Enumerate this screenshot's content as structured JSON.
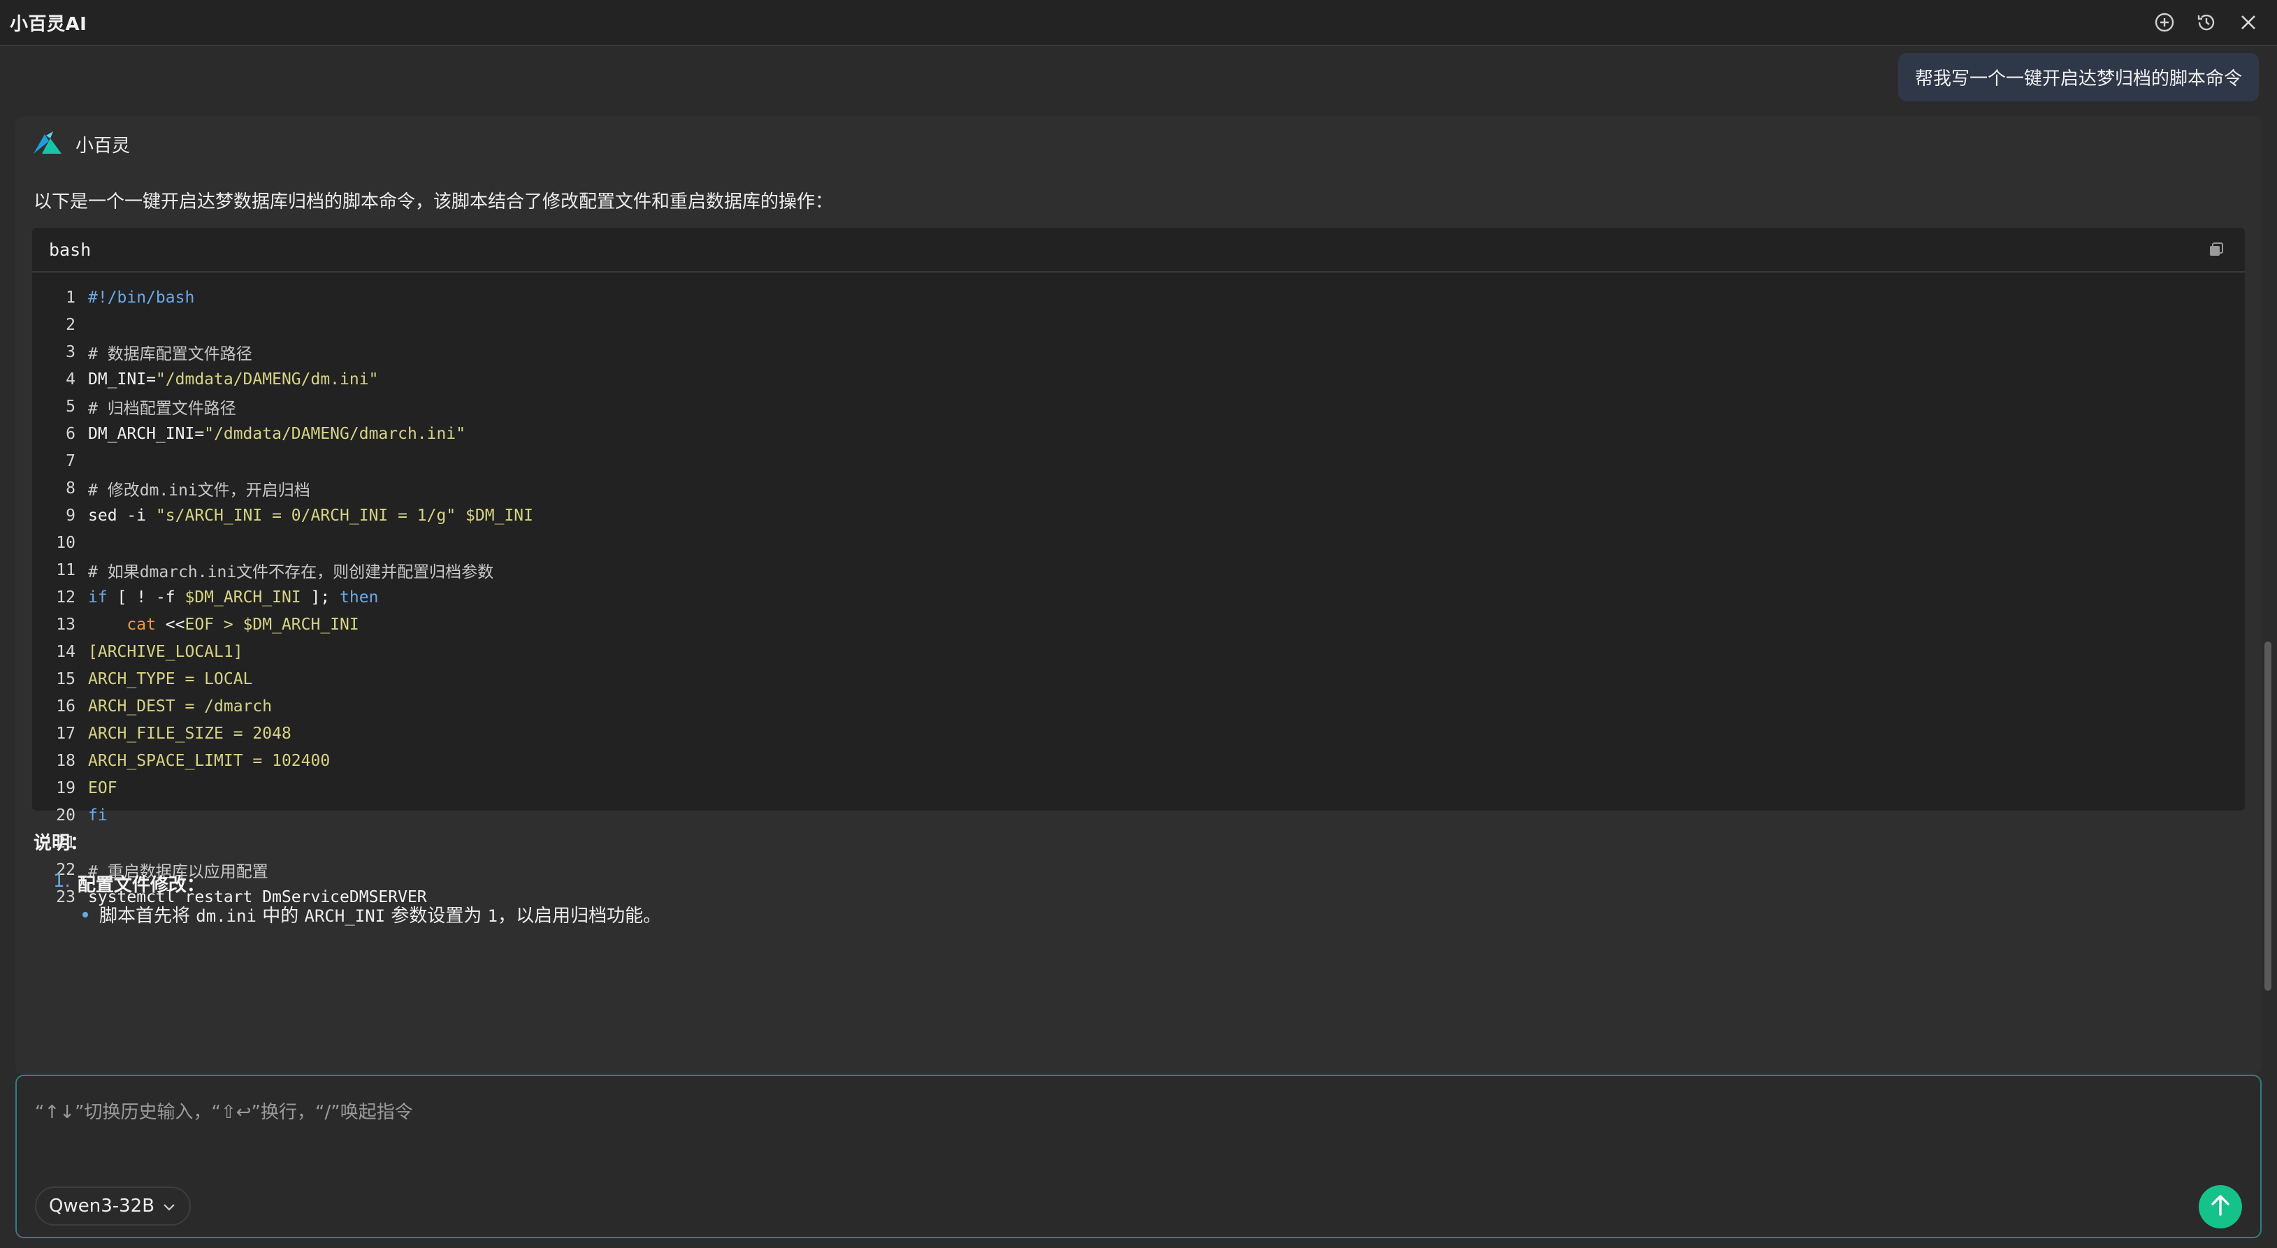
{
  "app": {
    "title": "小百灵AI"
  },
  "titlebar": {
    "icons": [
      "new-chat-icon",
      "history-icon",
      "close-icon"
    ]
  },
  "conversation": {
    "user_message": "帮我写一个一键开启达梦归档的脚本命令",
    "bot_name": "小百灵",
    "intro": "以下是一个一键开启达梦数据库归档的脚本命令，该脚本结合了修改配置文件和重启数据库的操作：",
    "code": {
      "lang": "bash",
      "lines": [
        {
          "n": "1",
          "segments": [
            {
              "t": "#!/bin/bash",
              "c": "kw"
            }
          ]
        },
        {
          "n": "2",
          "segments": []
        },
        {
          "n": "3",
          "segments": [
            {
              "t": "# 数据库配置文件路径",
              "c": "comment"
            }
          ]
        },
        {
          "n": "4",
          "segments": [
            {
              "t": "DM_INI=",
              "c": "plain"
            },
            {
              "t": "\"/dmdata/DAMENG/dm.ini\"",
              "c": "str"
            }
          ]
        },
        {
          "n": "5",
          "segments": [
            {
              "t": "# 归档配置文件路径",
              "c": "comment"
            }
          ]
        },
        {
          "n": "6",
          "segments": [
            {
              "t": "DM_ARCH_INI=",
              "c": "plain"
            },
            {
              "t": "\"/dmdata/DAMENG/dmarch.ini\"",
              "c": "str"
            }
          ]
        },
        {
          "n": "7",
          "segments": []
        },
        {
          "n": "8",
          "segments": [
            {
              "t": "# 修改dm.ini文件，开启归档",
              "c": "comment"
            }
          ]
        },
        {
          "n": "9",
          "segments": [
            {
              "t": "sed -i ",
              "c": "plain"
            },
            {
              "t": "\"s/ARCH_INI = 0/ARCH_INI = 1/g\"",
              "c": "str"
            },
            {
              "t": " $DM_INI",
              "c": "var"
            }
          ]
        },
        {
          "n": "10",
          "segments": []
        },
        {
          "n": "11",
          "segments": [
            {
              "t": "# 如果dmarch.ini文件不存在，则创建并配置归档参数",
              "c": "comment"
            }
          ]
        },
        {
          "n": "12",
          "segments": [
            {
              "t": "if",
              "c": "kw"
            },
            {
              "t": " [ ! -f ",
              "c": "plain"
            },
            {
              "t": "$DM_ARCH_INI",
              "c": "var"
            },
            {
              "t": " ]; ",
              "c": "plain"
            },
            {
              "t": "then",
              "c": "kw"
            }
          ]
        },
        {
          "n": "13",
          "segments": [
            {
              "t": "    ",
              "c": "plain"
            },
            {
              "t": "cat",
              "c": "cmd"
            },
            {
              "t": " <<",
              "c": "plain"
            },
            {
              "t": "EOF > $DM_ARCH_INI",
              "c": "cfg"
            }
          ]
        },
        {
          "n": "14",
          "segments": [
            {
              "t": "[ARCHIVE_LOCAL1]",
              "c": "cfg"
            }
          ]
        },
        {
          "n": "15",
          "segments": [
            {
              "t": "ARCH_TYPE = LOCAL",
              "c": "cfg"
            }
          ]
        },
        {
          "n": "16",
          "segments": [
            {
              "t": "ARCH_DEST = /dmarch",
              "c": "cfg"
            }
          ]
        },
        {
          "n": "17",
          "segments": [
            {
              "t": "ARCH_FILE_SIZE = 2048",
              "c": "cfg"
            }
          ]
        },
        {
          "n": "18",
          "segments": [
            {
              "t": "ARCH_SPACE_LIMIT = 102400",
              "c": "cfg"
            }
          ]
        },
        {
          "n": "19",
          "segments": [
            {
              "t": "EOF",
              "c": "cfg"
            }
          ]
        },
        {
          "n": "20",
          "segments": [
            {
              "t": "fi",
              "c": "kw"
            }
          ]
        },
        {
          "n": "21",
          "segments": []
        },
        {
          "n": "22",
          "segments": [
            {
              "t": "# 重启数据库以应用配置",
              "c": "comment"
            }
          ]
        },
        {
          "n": "23",
          "segments": [
            {
              "t": "systemctl restart DmServiceDMSERVER",
              "c": "plain"
            }
          ]
        }
      ]
    },
    "explain_title": "说明：",
    "list": [
      {
        "num": "1.",
        "title": "配置文件修改：",
        "sub": [
          "脚本首先将",
          "dm.ini",
          "中的",
          "ARCH_INI",
          "参数设置为",
          "1",
          "，以启用归档功能。"
        ]
      }
    ]
  },
  "input": {
    "placeholder": "“↑↓”切换历史输入，“⇧↩”换行，“/”唤起指令",
    "model": "Qwen3-32B"
  },
  "colors": {
    "accent": "#14c28a",
    "focus_border": "#2f7f7f",
    "keyword": "#6aa8e8",
    "string": "#d7d384",
    "command": "#e89a3c"
  }
}
